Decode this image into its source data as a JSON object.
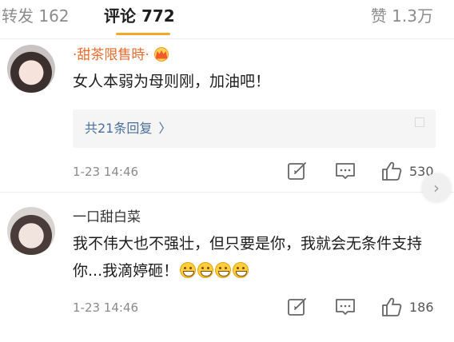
{
  "tabs": {
    "repost": "转发 162",
    "comments": "评论 772",
    "likes": "赞 1.3万",
    "accent_color": "#f4a72a"
  },
  "comments": [
    {
      "username": "·甜茶限售時·",
      "username_color": "#e86a2c",
      "badge": "vip-crown-icon",
      "text": "女人本弱为母则刚，加油吧！",
      "replies_link": "共21条回复",
      "time": "1-23 14:46",
      "likes": "530"
    },
    {
      "username": "一口甜白菜",
      "text": "我不伟大也不强壮，但只要是你，我就会无条件支持你...我滴婷砸！",
      "emoji_icon": "grin-emoji-icon",
      "time": "1-23 14:46",
      "likes": "186"
    }
  ],
  "icons": {
    "share": "share-icon",
    "reply": "comment-icon",
    "like": "thumb-up-icon",
    "more": "chevron-right-icon"
  }
}
